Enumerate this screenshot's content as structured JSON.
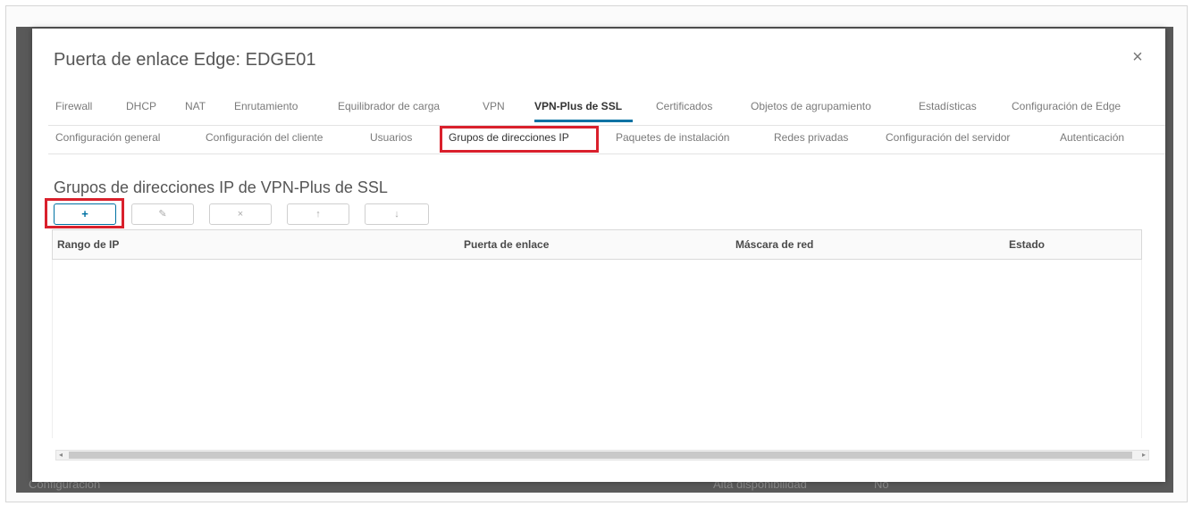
{
  "background": {
    "bottom_left_text": "Configuración",
    "bottom_mid_text": "Alta disponibilidad",
    "bottom_right_text": "No"
  },
  "dialog": {
    "title": "Puerta de enlace Edge: EDGE01",
    "close_glyph": "×"
  },
  "primary_tabs": [
    {
      "label": "Firewall"
    },
    {
      "label": "DHCP"
    },
    {
      "label": "NAT"
    },
    {
      "label": "Enrutamiento"
    },
    {
      "label": "Equilibrador de carga"
    },
    {
      "label": "VPN"
    },
    {
      "label": "VPN-Plus de SSL",
      "active": true
    },
    {
      "label": "Certificados"
    },
    {
      "label": "Objetos de agrupamiento"
    },
    {
      "label": "Estadísticas"
    },
    {
      "label": "Configuración de Edge"
    }
  ],
  "secondary_tabs": [
    {
      "label": "Configuración general"
    },
    {
      "label": "Configuración del cliente"
    },
    {
      "label": "Usuarios"
    },
    {
      "label": "Grupos de direcciones IP",
      "active": true
    },
    {
      "label": "Paquetes de instalación"
    },
    {
      "label": "Redes privadas"
    },
    {
      "label": "Configuración del servidor"
    },
    {
      "label": "Autenticación"
    }
  ],
  "section": {
    "title": "Grupos de direcciones IP de VPN-Plus de SSL"
  },
  "toolbar": {
    "add_glyph": "+",
    "edit_glyph": "✎",
    "delete_glyph": "×",
    "up_glyph": "↑",
    "down_glyph": "↓"
  },
  "table": {
    "columns": [
      "Rango de IP",
      "Puerta de enlace",
      "Máscara de red",
      "Estado"
    ],
    "rows": []
  },
  "scrollbar": {
    "left_arrow": "◂",
    "right_arrow": "▸"
  },
  "colors": {
    "accent": "#0072a3",
    "highlight": "#d9202c"
  }
}
